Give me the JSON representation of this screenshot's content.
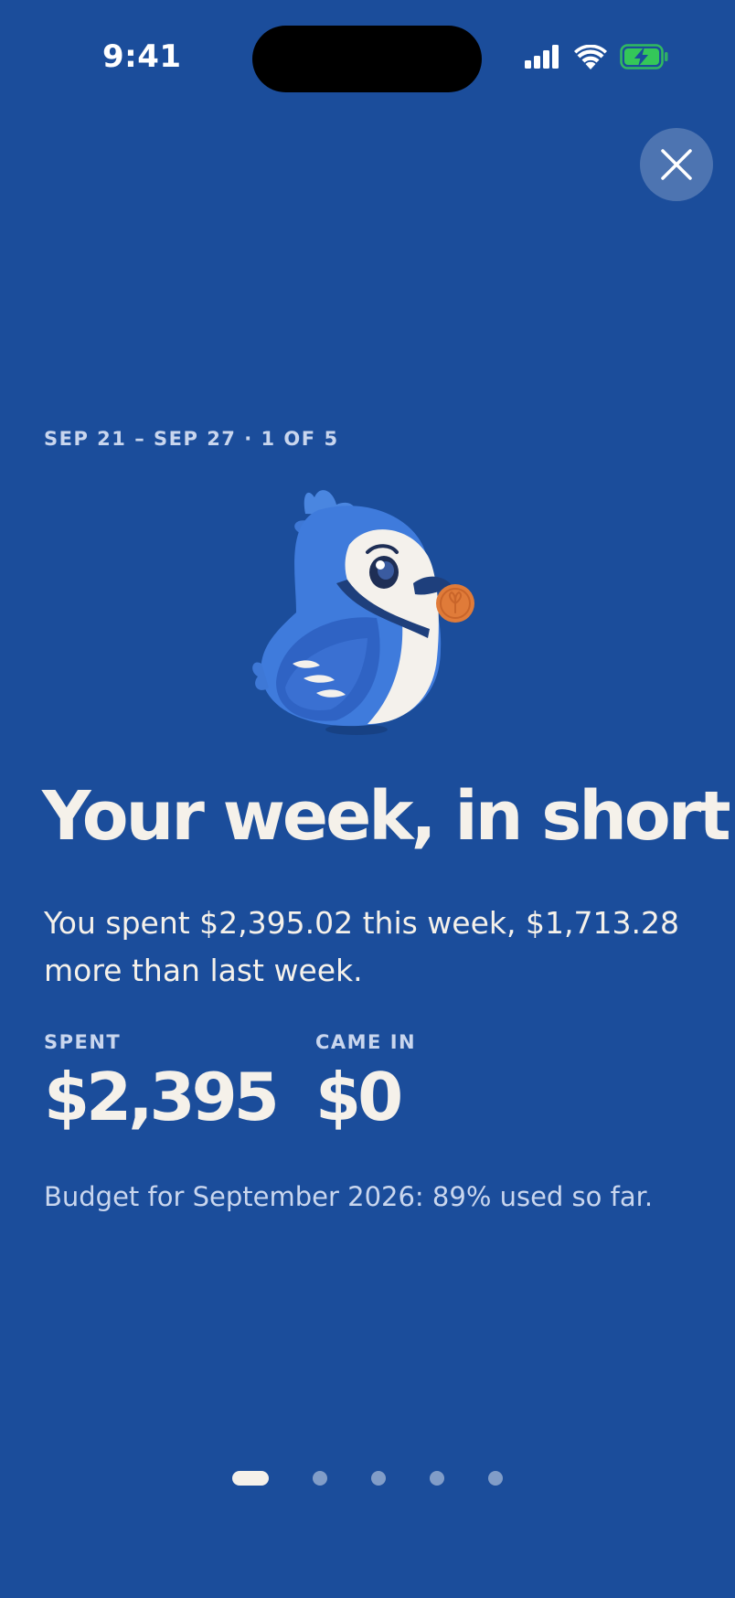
{
  "status_bar": {
    "time": "9:41"
  },
  "story": {
    "date_range": "SEP 21 – SEP 27 · 1 OF 5",
    "title": "Your week, in short",
    "summary": "You spent $2,395.02 this week, $1,713.28 more than last week.",
    "stats": [
      {
        "label": "SPENT",
        "value": "$2,395"
      },
      {
        "label": "CAME IN",
        "value": "$0"
      }
    ],
    "budget_note": "Budget for September 2026: 89% used so far."
  },
  "pager": {
    "total": 5,
    "current": 1
  },
  "icons": {
    "close": "close-icon",
    "signal": "cellular-signal-icon",
    "wifi": "wifi-icon",
    "battery": "battery-charging-icon",
    "mascot": "blue-jay-mascot"
  },
  "colors": {
    "background": "#1B4D9B",
    "text_primary": "#F5F1EA",
    "text_secondary": "#C9D6EE",
    "battery_green": "#34C759",
    "coin": "#E07B39"
  }
}
